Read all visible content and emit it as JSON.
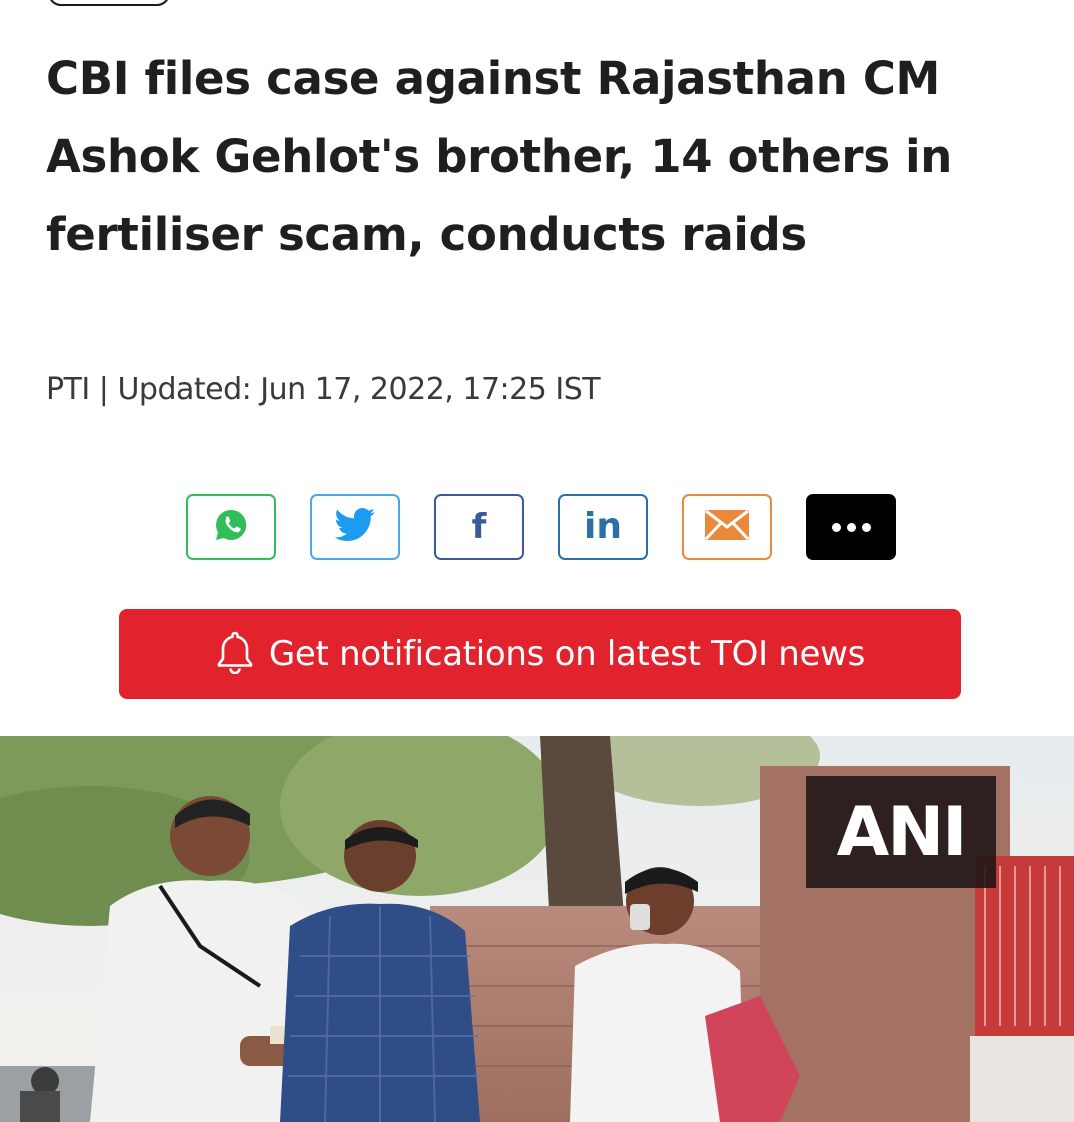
{
  "article": {
    "headline": "CBI files case against Rajasthan CM Ashok Gehlot's brother, 14 others in fertiliser scam, conducts raids",
    "byline": "PTI | Updated: Jun 17, 2022, 17:25 IST"
  },
  "share": {
    "buttons": [
      {
        "name": "whatsapp",
        "icon": "whatsapp-icon",
        "color": "#2fbe5a"
      },
      {
        "name": "twitter",
        "icon": "twitter-icon",
        "color": "#4aa8e6"
      },
      {
        "name": "facebook",
        "icon": "facebook-icon",
        "glyph": "f",
        "color": "#3b5a99"
      },
      {
        "name": "linkedin",
        "icon": "linkedin-icon",
        "glyph": "in",
        "color": "#2a6fa8"
      },
      {
        "name": "email",
        "icon": "mail-icon",
        "color": "#e9893a"
      },
      {
        "name": "more",
        "icon": "more-icon",
        "color": "#000000"
      }
    ]
  },
  "notification": {
    "label": "Get notifications on latest TOI news",
    "icon": "bell-icon",
    "color": "#e1232d"
  },
  "hero_image": {
    "watermark": "ANI"
  }
}
